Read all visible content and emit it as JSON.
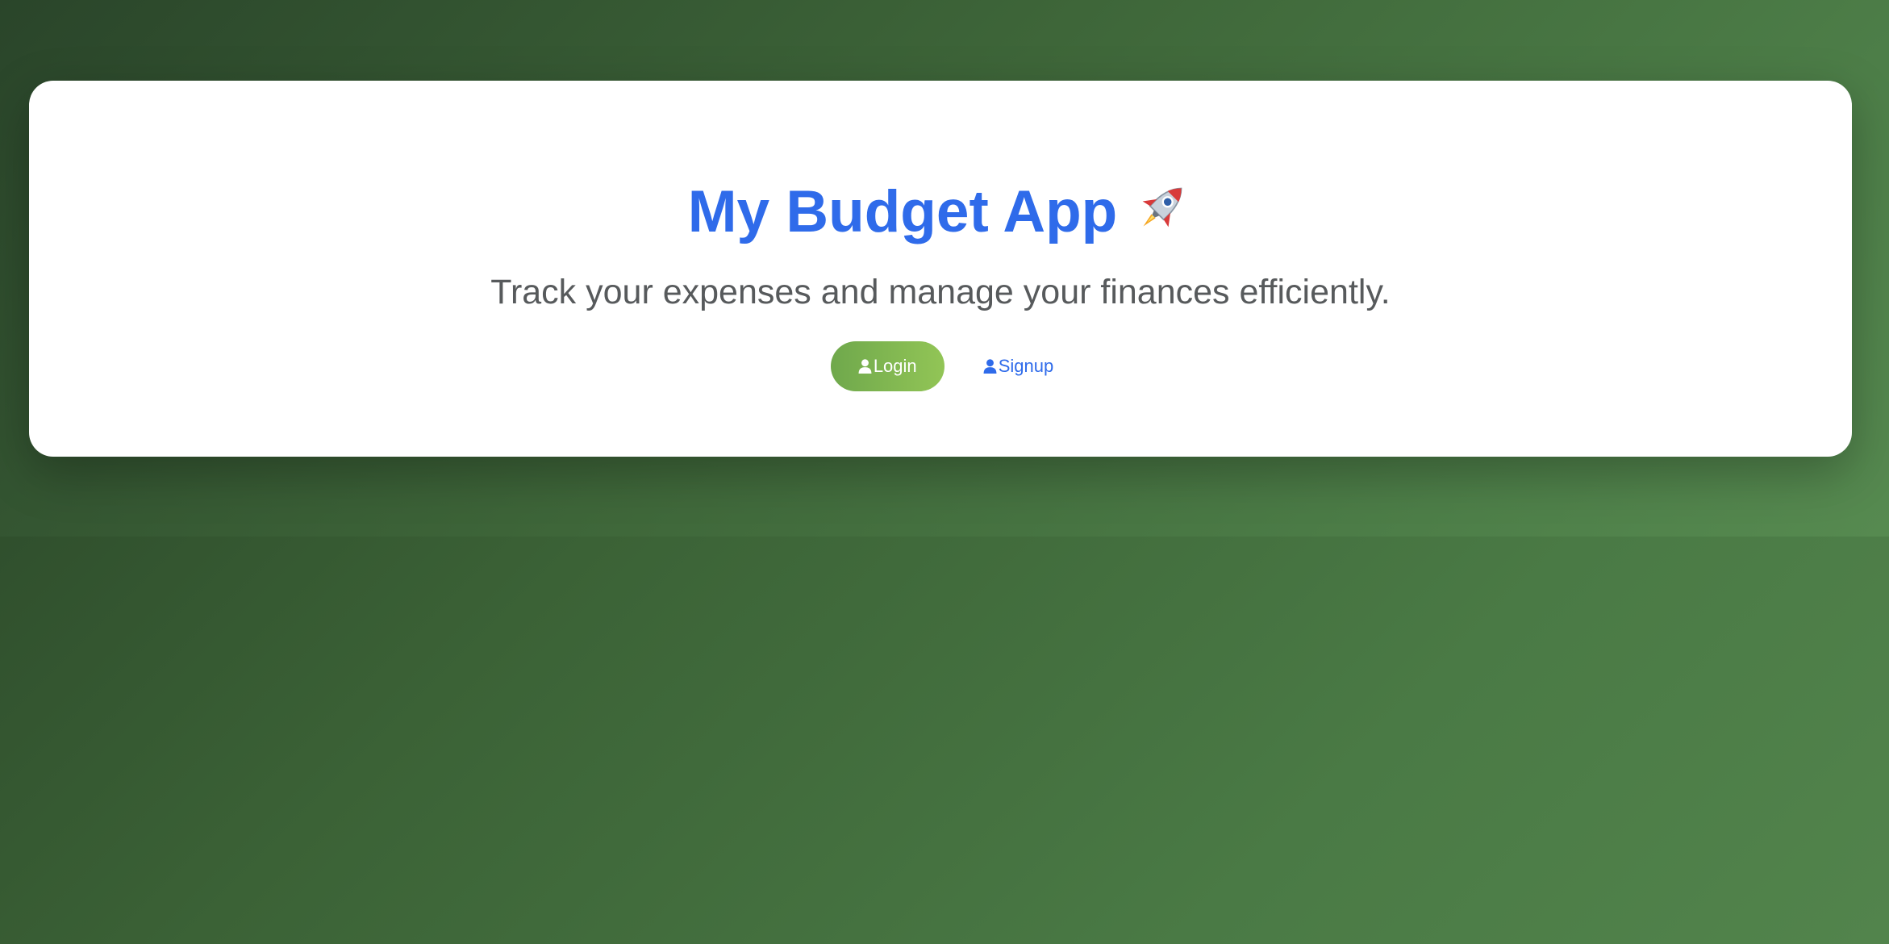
{
  "app": {
    "title": "My Budget App",
    "title_icon": "rocket-icon",
    "subtitle": "Track your expenses and manage your finances efficiently."
  },
  "actions": {
    "login": {
      "label": "Login",
      "icon": "user-icon"
    },
    "signup": {
      "label": "Signup",
      "icon": "user-icon"
    }
  },
  "colors": {
    "accent": "#2f6bea",
    "login_gradient_start": "#6fa84c",
    "login_gradient_end": "#92c556",
    "subtitle_text": "#575a5c",
    "background_dark": "#263f25",
    "background_light": "#52844c"
  }
}
